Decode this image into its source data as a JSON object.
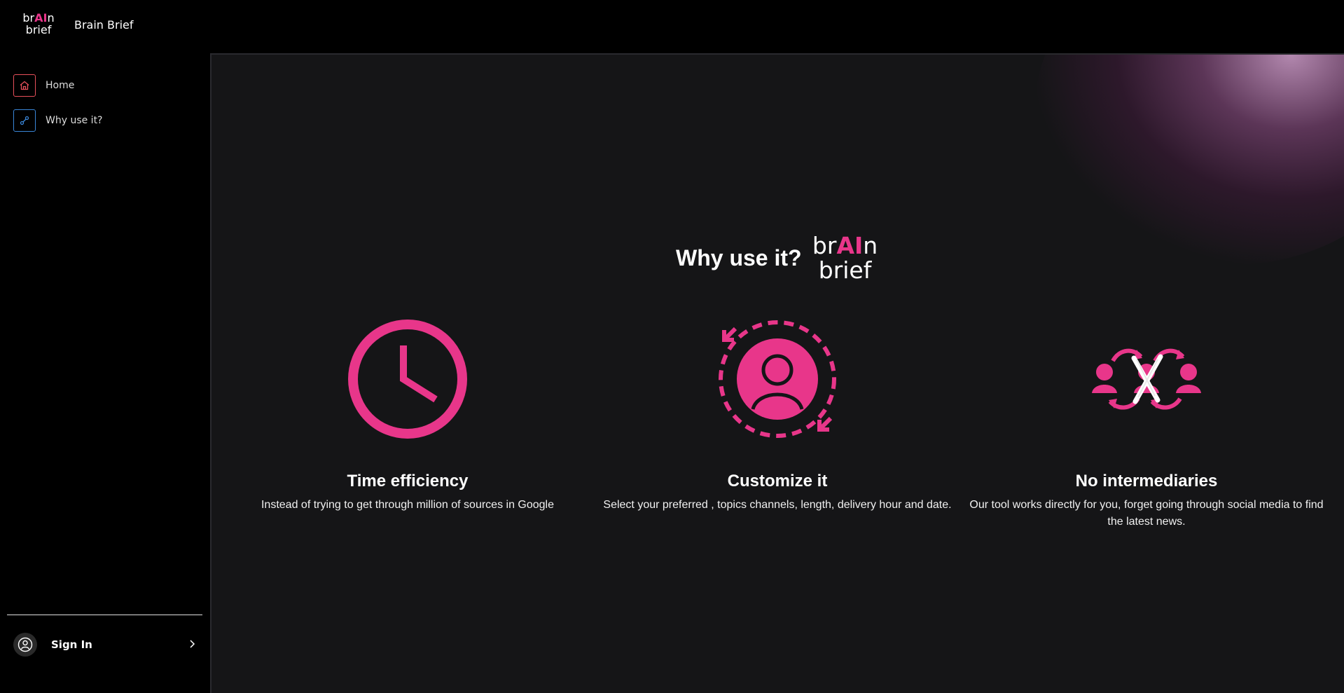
{
  "app": {
    "logo_top_pre": "br",
    "logo_top_ai": "AI",
    "logo_top_post": "n",
    "logo_bottom": "brief",
    "name": "Brain Brief"
  },
  "sidebar": {
    "items": [
      {
        "label": "Home",
        "icon": "home-icon"
      },
      {
        "label": "Why use it?",
        "icon": "link-icon"
      }
    ],
    "signin_label": "Sign In"
  },
  "main": {
    "headline": "Why use it?",
    "features": [
      {
        "icon": "clock-icon",
        "title": "Time efficiency",
        "description": "Instead of trying to get through million of sources in Google"
      },
      {
        "icon": "customize-user-icon",
        "title": "Customize it",
        "description": "Select your preferred , topics channels, length, delivery hour and date."
      },
      {
        "icon": "no-intermediaries-icon",
        "title": "No intermediaries",
        "description": "Our tool works directly for you, forget going through social media to find the latest news."
      }
    ]
  },
  "colors": {
    "accent": "#e8368a",
    "background": "#000000",
    "panel": "#151517",
    "home_icon": "#e8505b",
    "why_icon": "#3a86d8"
  }
}
